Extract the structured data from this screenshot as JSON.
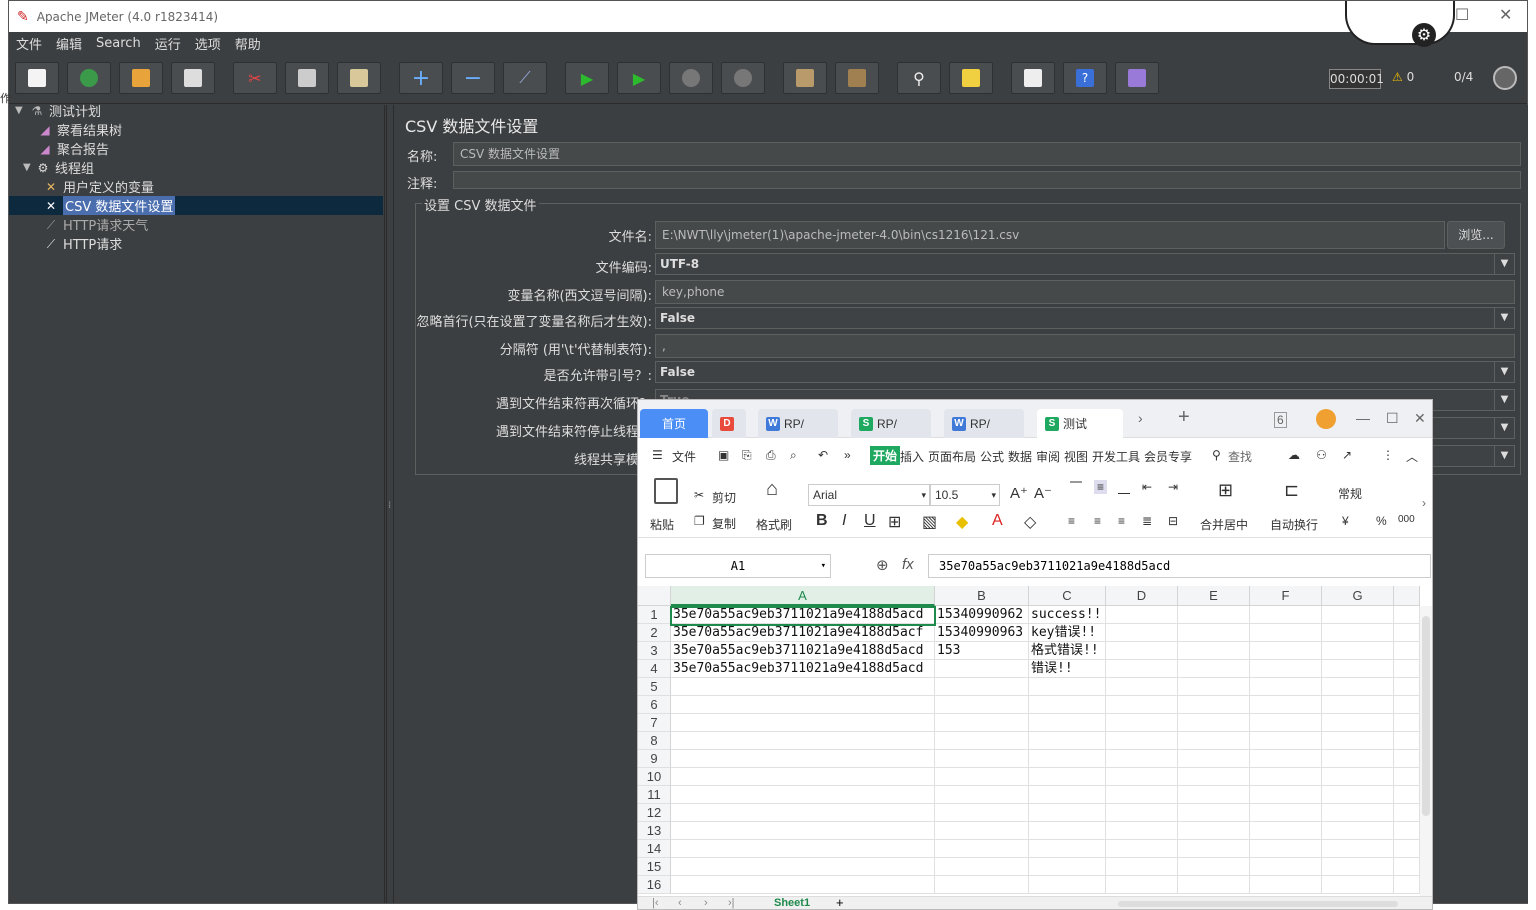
{
  "window": {
    "title": "Apache JMeter (4.0 r1823414)"
  },
  "menu": [
    "文件",
    "编辑",
    "Search",
    "运行",
    "选项",
    "帮助"
  ],
  "toolbar": {
    "timer": "00:00:01",
    "warnings": "0",
    "threads": "0/4",
    "buttons": [
      "new-icon",
      "templates-icon",
      "open-icon",
      "save-icon",
      "cut-icon",
      "copy-icon",
      "paste-icon",
      "expand-icon",
      "collapse-icon",
      "toggle-icon",
      "start-icon",
      "start-no-pause-icon",
      "stop-icon",
      "shutdown-icon",
      "clear-icon",
      "clear-all-icon",
      "search-icon",
      "reset-search-icon",
      "function-helper-icon",
      "help-icon",
      "remote-icon"
    ]
  },
  "tree": {
    "items": [
      {
        "label": "测试计划",
        "icon": "test-plan-icon"
      },
      {
        "label": "察看结果树",
        "icon": "listener-icon"
      },
      {
        "label": "聚合报告",
        "icon": "listener-icon"
      },
      {
        "label": "线程组",
        "icon": "thread-group-icon"
      },
      {
        "label": "用户定义的变量",
        "icon": "config-icon"
      },
      {
        "label": "CSV 数据文件设置",
        "icon": "config-icon"
      },
      {
        "label": "HTTP请求天气",
        "icon": "sampler-icon"
      },
      {
        "label": "HTTP请求",
        "icon": "sampler-icon"
      }
    ]
  },
  "panel": {
    "title": "CSV 数据文件设置",
    "name_label": "名称:",
    "name_value": "CSV 数据文件设置",
    "comment_label": "注释:",
    "comment_value": "",
    "group_title": "设置 CSV 数据文件",
    "browse_label": "浏览...",
    "fields": [
      {
        "label": "文件名:",
        "value": "E:\\NWT\\lly\\jmeter(1)\\apache-jmeter-4.0\\bin\\cs1216\\121.csv",
        "type": "text"
      },
      {
        "label": "文件编码:",
        "value": "UTF-8",
        "type": "select"
      },
      {
        "label": "变量名称(西文逗号间隔):",
        "value": "key,phone",
        "type": "text"
      },
      {
        "label": "忽略首行(只在设置了变量名称后才生效):",
        "value": "False",
        "type": "select"
      },
      {
        "label": "分隔符 (用'\\t'代替制表符):",
        "value": ",",
        "type": "text"
      },
      {
        "label": "是否允许带引号？:",
        "value": "False",
        "type": "select"
      },
      {
        "label": "遇到文件结束符再次循环？",
        "value": "True",
        "type": "select"
      },
      {
        "label": "遇到文件结束符停止线程？",
        "value": "",
        "type": "select"
      },
      {
        "label": "线程共享模式",
        "value": "",
        "type": "select"
      }
    ]
  },
  "spreadsheet": {
    "tabs": [
      {
        "label": "首页",
        "badge": ""
      },
      {
        "label": "",
        "badge": "D"
      },
      {
        "label": "RP/",
        "badge": "W"
      },
      {
        "label": "RP/",
        "badge": "S"
      },
      {
        "label": "RP/",
        "badge": "W"
      },
      {
        "label": "测试",
        "badge": "S"
      }
    ],
    "menu": [
      "文件",
      "开始",
      "插入",
      "页面布局",
      "公式",
      "数据",
      "审阅",
      "视图",
      "开发工具",
      "会员专享",
      "查找"
    ],
    "ribbon": {
      "paste": "粘贴",
      "cut": "剪切",
      "copy": "复制",
      "format_painter": "格式刷",
      "font": "Arial",
      "size": "10.5",
      "merge": "合并居中",
      "wrap": "自动换行",
      "number_format": "常规",
      "currency": "¥",
      "percent": "%"
    },
    "name_box": "A1",
    "formula": "35e70a55ac9eb3711021a9e4188d5acd",
    "columns": [
      "A",
      "B",
      "C",
      "D",
      "E",
      "F",
      "G"
    ],
    "rows": [
      [
        "35e70a55ac9eb3711021a9e4188d5acd",
        "15340990962",
        "success!!"
      ],
      [
        "35e70a55ac9eb3711021a9e4188d5acf",
        "15340990963",
        "key错误!!"
      ],
      [
        "35e70a55ac9eb3711021a9e4188d5acd",
        "153",
        "格式错误!!"
      ],
      [
        "35e70a55ac9eb3711021a9e4188d5acd",
        "",
        "错误!!"
      ]
    ],
    "row_numbers": [
      "1",
      "2",
      "3",
      "4",
      "5",
      "6",
      "7",
      "8",
      "9",
      "10",
      "11",
      "12",
      "13",
      "14",
      "15",
      "16"
    ],
    "sheet_tab": "Sheet1"
  }
}
